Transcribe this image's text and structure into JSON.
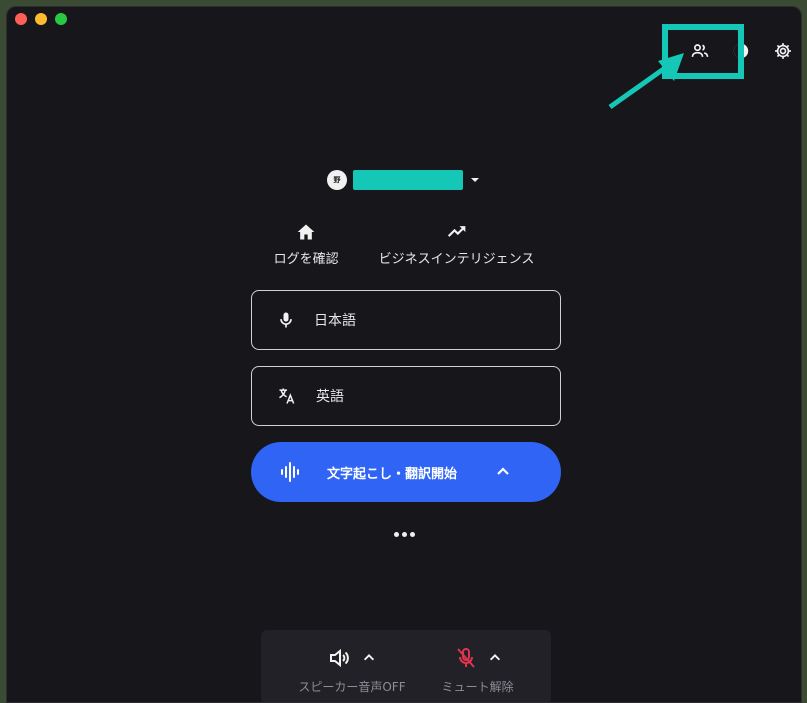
{
  "window": {
    "controls": [
      "close",
      "minimize",
      "maximize"
    ]
  },
  "toolbar": {
    "icons": [
      "people-icon",
      "theme-icon",
      "gear-icon"
    ]
  },
  "account": {
    "avatar_text": "野"
  },
  "nav": {
    "log_label": "ログを確認",
    "bi_label": "ビジネスインテリジェンス"
  },
  "language": {
    "source": "日本語",
    "target": "英語"
  },
  "start_button": {
    "label": "文字起こし・翻訳開始"
  },
  "bottom": {
    "speaker_label": "スピーカー音声OFF",
    "mute_label": "ミュート解除"
  },
  "colors": {
    "accent": "#2f64f5",
    "annotation": "#14c7b6",
    "mic_muted": "#e0344e"
  }
}
